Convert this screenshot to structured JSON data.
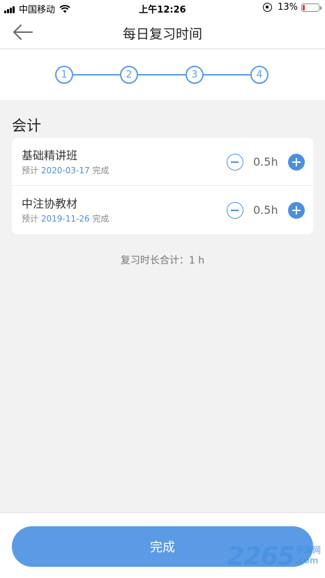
{
  "status_bar": {
    "carrier": "中国移动",
    "time": "上午12:26",
    "battery": "13%",
    "battery_level": 0.13
  },
  "nav": {
    "title": "每日复习时间"
  },
  "stepper": {
    "steps": [
      "1",
      "2",
      "3",
      "4"
    ]
  },
  "section": {
    "title": "会计"
  },
  "courses": [
    {
      "name": "基础精讲班",
      "expect_label": "预计",
      "date": "2020-03-17",
      "finish_label": "完成",
      "hours": "0.5h"
    },
    {
      "name": "中注协教材",
      "expect_label": "预计",
      "date": "2019-11-26",
      "finish_label": "完成",
      "hours": "0.5h"
    }
  ],
  "total": {
    "text": "复习时长合计：1 h"
  },
  "footer": {
    "done_label": "完成"
  },
  "watermark": {
    "number": "2265",
    "line1": "手游网",
    "line2": ".com"
  },
  "colors": {
    "accent": "#5b9be6",
    "accent_dark": "#4a8fe0",
    "background": "#f2f2f2"
  }
}
